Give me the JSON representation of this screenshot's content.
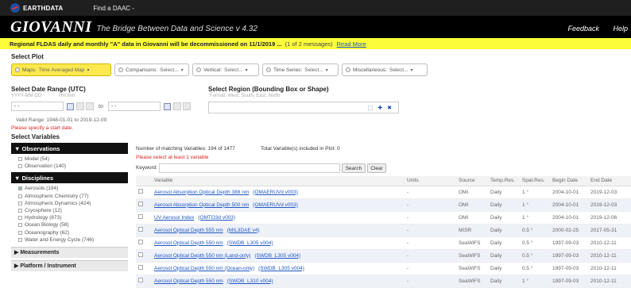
{
  "topbar": {
    "brand": "EARTHDATA",
    "find_daac": "Find a DAAC -"
  },
  "header": {
    "title": "GIOVANNI",
    "tagline": "The Bridge Between Data and Science  v 4.32",
    "feedback": "Feedback",
    "help": "Help"
  },
  "alert": {
    "message": "Regional FLDAS daily and monthly \"A\" data in Giovanni will be decommissioned on 11/1/2019 ...",
    "count": "(1 of 2 messages)",
    "read_more": "Read More"
  },
  "select_plot": {
    "label": "Select Plot",
    "buttons": [
      {
        "label": "Maps:",
        "selected": "Time Averaged Map",
        "active": true
      },
      {
        "label": "Comparisons:",
        "selected": "Select...",
        "active": false
      },
      {
        "label": "Vertical:",
        "selected": "Select...",
        "active": false
      },
      {
        "label": "Time Series:",
        "selected": "Select...",
        "active": false
      },
      {
        "label": "Miscellaneous:",
        "selected": "Select...",
        "active": false
      }
    ]
  },
  "date_range": {
    "label": "Select Date Range (UTC)",
    "date_hint": "YYYY-MM-DD",
    "time_hint": "HH:mm",
    "to": "to",
    "start_value": "- -",
    "end_value": "- -",
    "valid_range": "Valid Range: 1948-01-01 to 2019-12-09",
    "error": "Please specify a start date."
  },
  "region": {
    "label": "Select Region (Bounding Box or Shape)",
    "hint": "Format: West, South, East, North",
    "icons": "⬚ ✚ ✖"
  },
  "select_variables": {
    "label": "Select Variables"
  },
  "sidebar": {
    "observations": {
      "label": "Observations",
      "items": [
        "Model (54)",
        "Observation (140)"
      ]
    },
    "disciplines": {
      "label": "Disciplines",
      "items": [
        {
          "label": "Aerosols (194)",
          "checked": true
        },
        {
          "label": "Atmospheric Chemistry (77)",
          "checked": false
        },
        {
          "label": "Atmospheric Dynamics (424)",
          "checked": false
        },
        {
          "label": "Cryosphere (12)",
          "checked": false
        },
        {
          "label": "Hydrology (873)",
          "checked": false
        },
        {
          "label": "Ocean Biology (58)",
          "checked": false
        },
        {
          "label": "Oceanography (62)",
          "checked": false
        },
        {
          "label": "Water and Energy Cycle (746)",
          "checked": false
        }
      ]
    },
    "measurements": "Measurements",
    "platform": "Platform / Instrument"
  },
  "variables": {
    "matching": "Number of matching Variables: 194 of 1477",
    "included": "Total Variable(s) included in Plot: 0",
    "select_warning": "Please select at least 1 variable",
    "keyword_label": "Keyword:",
    "search": "Search",
    "clear": "Clear",
    "columns": [
      "Variable",
      "Units",
      "Source",
      "Temp.Res.",
      "Spat.Res.",
      "Begin Date",
      "End Date"
    ],
    "rows": [
      {
        "name": "Aerosol Absorption Optical Depth 388 nm",
        "short": "(OMAERUVd v003)",
        "units": "-",
        "source": "OMI",
        "temp": "Daily",
        "spat": "1 °",
        "begin": "2004-10-01",
        "end": "2019-12-03"
      },
      {
        "name": "Aerosol Absorption Optical Depth 500 nm",
        "short": "(OMAERUVd v003)",
        "units": "-",
        "source": "OMI",
        "temp": "Daily",
        "spat": "1 °",
        "begin": "2004-10-01",
        "end": "2019-12-03"
      },
      {
        "name": "UV Aerosol Index",
        "short": "(OMTO3d v003)",
        "units": "-",
        "source": "OMI",
        "temp": "Daily",
        "spat": "1 °",
        "begin": "2004-10-01",
        "end": "2019-12-06"
      },
      {
        "name": "Aerosol Optical Depth 555 nm",
        "short": "(MIL3DAE v4)",
        "units": "-",
        "source": "MISR",
        "temp": "Daily",
        "spat": "0.5 °",
        "begin": "2000-02-25",
        "end": "2017-05-31"
      },
      {
        "name": "Aerosol Optical Depth 550 nm",
        "short": "(SWDB_L305 v004)",
        "units": "-",
        "source": "SeaWiFS",
        "temp": "Daily",
        "spat": "0.5 °",
        "begin": "1997-09-03",
        "end": "2010-12-11"
      },
      {
        "name": "Aerosol Optical Depth 550 nm (Land-only)",
        "short": "(SWDB_L305 v004)",
        "units": "-",
        "source": "SeaWiFS",
        "temp": "Daily",
        "spat": "0.5 °",
        "begin": "1997-09-03",
        "end": "2010-12-11"
      },
      {
        "name": "Aerosol Optical Depth 550 nm (Ocean-only)",
        "short": "(SWDB_L305 v004)",
        "units": "-",
        "source": "SeaWiFS",
        "temp": "Daily",
        "spat": "0.5 °",
        "begin": "1997-09-03",
        "end": "2010-12-11"
      },
      {
        "name": "Aerosol Optical Depth 550 nm",
        "short": "(SWDB_L310 v004)",
        "units": "-",
        "source": "SeaWiFS",
        "temp": "Daily",
        "spat": "1 °",
        "begin": "1997-09-03",
        "end": "2010-12-11"
      }
    ]
  }
}
